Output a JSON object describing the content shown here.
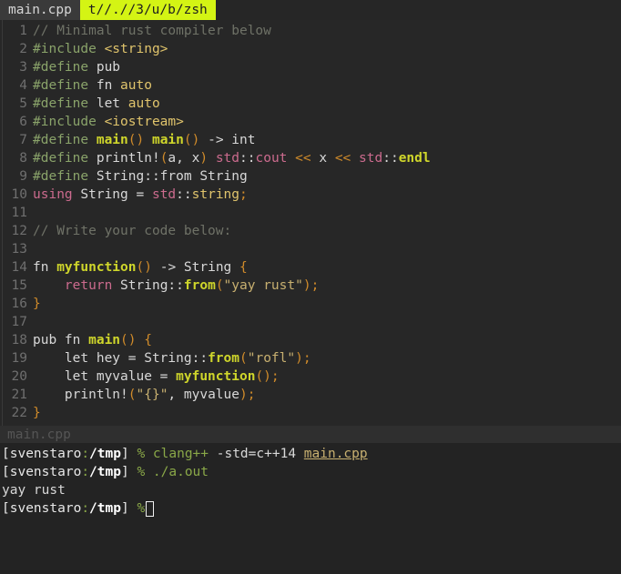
{
  "tabbar": {
    "tabs": [
      {
        "label": "main.cpp",
        "active": false
      },
      {
        "label": "t//.//3/u/b/zsh",
        "active": true
      }
    ],
    "active_bg": "#d4f414",
    "inactive_bg": "#3a3a3a"
  },
  "editor": {
    "filename": "main.cpp",
    "lines": [
      {
        "num": "1",
        "tokens": [
          {
            "t": "// Minimal rust compiler below",
            "c": "t-comment"
          }
        ]
      },
      {
        "num": "2",
        "tokens": [
          {
            "t": "#include ",
            "c": "t-pre"
          },
          {
            "t": "<string>",
            "c": "t-inc"
          }
        ]
      },
      {
        "num": "3",
        "tokens": [
          {
            "t": "#define ",
            "c": "t-pre"
          },
          {
            "t": "pub",
            "c": "t-plain"
          }
        ]
      },
      {
        "num": "4",
        "tokens": [
          {
            "t": "#define ",
            "c": "t-pre"
          },
          {
            "t": "fn ",
            "c": "t-plain"
          },
          {
            "t": "auto",
            "c": "t-type"
          }
        ]
      },
      {
        "num": "5",
        "tokens": [
          {
            "t": "#define ",
            "c": "t-pre"
          },
          {
            "t": "let ",
            "c": "t-plain"
          },
          {
            "t": "auto",
            "c": "t-type"
          }
        ]
      },
      {
        "num": "6",
        "tokens": [
          {
            "t": "#include ",
            "c": "t-pre"
          },
          {
            "t": "<iostream>",
            "c": "t-inc"
          }
        ]
      },
      {
        "num": "7",
        "tokens": [
          {
            "t": "#define ",
            "c": "t-pre"
          },
          {
            "t": "main",
            "c": "t-fn"
          },
          {
            "t": "()",
            "c": "t-punct"
          },
          {
            "t": " ",
            "c": "t-plain"
          },
          {
            "t": "main",
            "c": "t-fn"
          },
          {
            "t": "()",
            "c": "t-punct"
          },
          {
            "t": " ",
            "c": "t-plain"
          },
          {
            "t": "->",
            "c": "t-plain"
          },
          {
            "t": " int",
            "c": "t-plain"
          }
        ]
      },
      {
        "num": "8",
        "tokens": [
          {
            "t": "#define ",
            "c": "t-pre"
          },
          {
            "t": "println!",
            "c": "t-plain"
          },
          {
            "t": "(",
            "c": "t-punct"
          },
          {
            "t": "a, x",
            "c": "t-plain"
          },
          {
            "t": ")",
            "c": "t-punct"
          },
          {
            "t": " ",
            "c": "t-plain"
          },
          {
            "t": "std",
            "c": "t-kw"
          },
          {
            "t": "::",
            "c": "t-plain"
          },
          {
            "t": "cout",
            "c": "t-kw"
          },
          {
            "t": " ",
            "c": "t-plain"
          },
          {
            "t": "<<",
            "c": "t-op"
          },
          {
            "t": " x ",
            "c": "t-plain"
          },
          {
            "t": "<<",
            "c": "t-op"
          },
          {
            "t": " ",
            "c": "t-plain"
          },
          {
            "t": "std",
            "c": "t-kw"
          },
          {
            "t": "::",
            "c": "t-plain"
          },
          {
            "t": "endl",
            "c": "t-fn"
          }
        ]
      },
      {
        "num": "9",
        "tokens": [
          {
            "t": "#define ",
            "c": "t-pre"
          },
          {
            "t": "String::from String",
            "c": "t-plain"
          }
        ]
      },
      {
        "num": "10",
        "tokens": [
          {
            "t": "using",
            "c": "t-kw"
          },
          {
            "t": " String = ",
            "c": "t-plain"
          },
          {
            "t": "std",
            "c": "t-kw"
          },
          {
            "t": "::",
            "c": "t-plain"
          },
          {
            "t": "string",
            "c": "t-type"
          },
          {
            "t": ";",
            "c": "t-punct"
          }
        ]
      },
      {
        "num": "11",
        "tokens": []
      },
      {
        "num": "12",
        "tokens": [
          {
            "t": "// Write your code below:",
            "c": "t-comment"
          }
        ]
      },
      {
        "num": "13",
        "tokens": []
      },
      {
        "num": "14",
        "tokens": [
          {
            "t": "fn ",
            "c": "t-plain"
          },
          {
            "t": "myfunction",
            "c": "t-fn"
          },
          {
            "t": "()",
            "c": "t-punct"
          },
          {
            "t": " -> String ",
            "c": "t-plain"
          },
          {
            "t": "{",
            "c": "t-punct"
          }
        ]
      },
      {
        "num": "15",
        "tokens": [
          {
            "t": "    ",
            "c": "t-plain"
          },
          {
            "t": "return",
            "c": "t-kw"
          },
          {
            "t": " String",
            "c": "t-plain"
          },
          {
            "t": "::",
            "c": "t-plain"
          },
          {
            "t": "from",
            "c": "t-fn"
          },
          {
            "t": "(",
            "c": "t-punct"
          },
          {
            "t": "\"yay rust\"",
            "c": "t-str"
          },
          {
            "t": ")",
            "c": "t-punct"
          },
          {
            "t": ";",
            "c": "t-punct"
          }
        ]
      },
      {
        "num": "16",
        "tokens": [
          {
            "t": "}",
            "c": "t-punct"
          }
        ]
      },
      {
        "num": "17",
        "tokens": []
      },
      {
        "num": "18",
        "tokens": [
          {
            "t": "pub fn ",
            "c": "t-plain"
          },
          {
            "t": "main",
            "c": "t-fn"
          },
          {
            "t": "()",
            "c": "t-punct"
          },
          {
            "t": " ",
            "c": "t-plain"
          },
          {
            "t": "{",
            "c": "t-punct"
          }
        ]
      },
      {
        "num": "19",
        "tokens": [
          {
            "t": "    let hey = String",
            "c": "t-plain"
          },
          {
            "t": "::",
            "c": "t-plain"
          },
          {
            "t": "from",
            "c": "t-fn"
          },
          {
            "t": "(",
            "c": "t-punct"
          },
          {
            "t": "\"rofl\"",
            "c": "t-str"
          },
          {
            "t": ")",
            "c": "t-punct"
          },
          {
            "t": ";",
            "c": "t-punct"
          }
        ]
      },
      {
        "num": "20",
        "tokens": [
          {
            "t": "    let myvalue = ",
            "c": "t-plain"
          },
          {
            "t": "myfunction",
            "c": "t-fn"
          },
          {
            "t": "()",
            "c": "t-punct"
          },
          {
            "t": ";",
            "c": "t-punct"
          }
        ]
      },
      {
        "num": "21",
        "tokens": [
          {
            "t": "    println!",
            "c": "t-plain"
          },
          {
            "t": "(",
            "c": "t-punct"
          },
          {
            "t": "\"{}\"",
            "c": "t-str"
          },
          {
            "t": ", myvalue",
            "c": "t-plain"
          },
          {
            "t": ")",
            "c": "t-punct"
          },
          {
            "t": ";",
            "c": "t-punct"
          }
        ]
      },
      {
        "num": "22",
        "tokens": [
          {
            "t": "}",
            "c": "t-punct"
          }
        ]
      }
    ],
    "filler_char": "~"
  },
  "statusline": {
    "filename": "main.cpp"
  },
  "terminal": {
    "lines": [
      {
        "type": "prompt",
        "user": "svenstaro",
        "path": "/tmp",
        "symbol": "%",
        "command": "clang++",
        "args": " -std=c++14 ",
        "file": "main.cpp",
        "cursor": false
      },
      {
        "type": "prompt",
        "user": "svenstaro",
        "path": "/tmp",
        "symbol": "%",
        "command": "./a.out",
        "args": "",
        "file": "",
        "cursor": false
      },
      {
        "type": "output",
        "text": "yay rust"
      },
      {
        "type": "prompt",
        "user": "svenstaro",
        "path": "/tmp",
        "symbol": "%",
        "command": "",
        "args": "",
        "file": "",
        "cursor": true
      }
    ]
  },
  "colors": {
    "editor_bg": "#272727",
    "terminal_bg": "#232323",
    "accent_tab": "#d4f414",
    "prompt_green": "#8aa848",
    "string": "#c8b070",
    "function": "#cfd62b",
    "punct": "#d08b2a",
    "keyword": "#cc6b8e",
    "preproc": "#8aa36a",
    "comment": "#6f7267"
  }
}
